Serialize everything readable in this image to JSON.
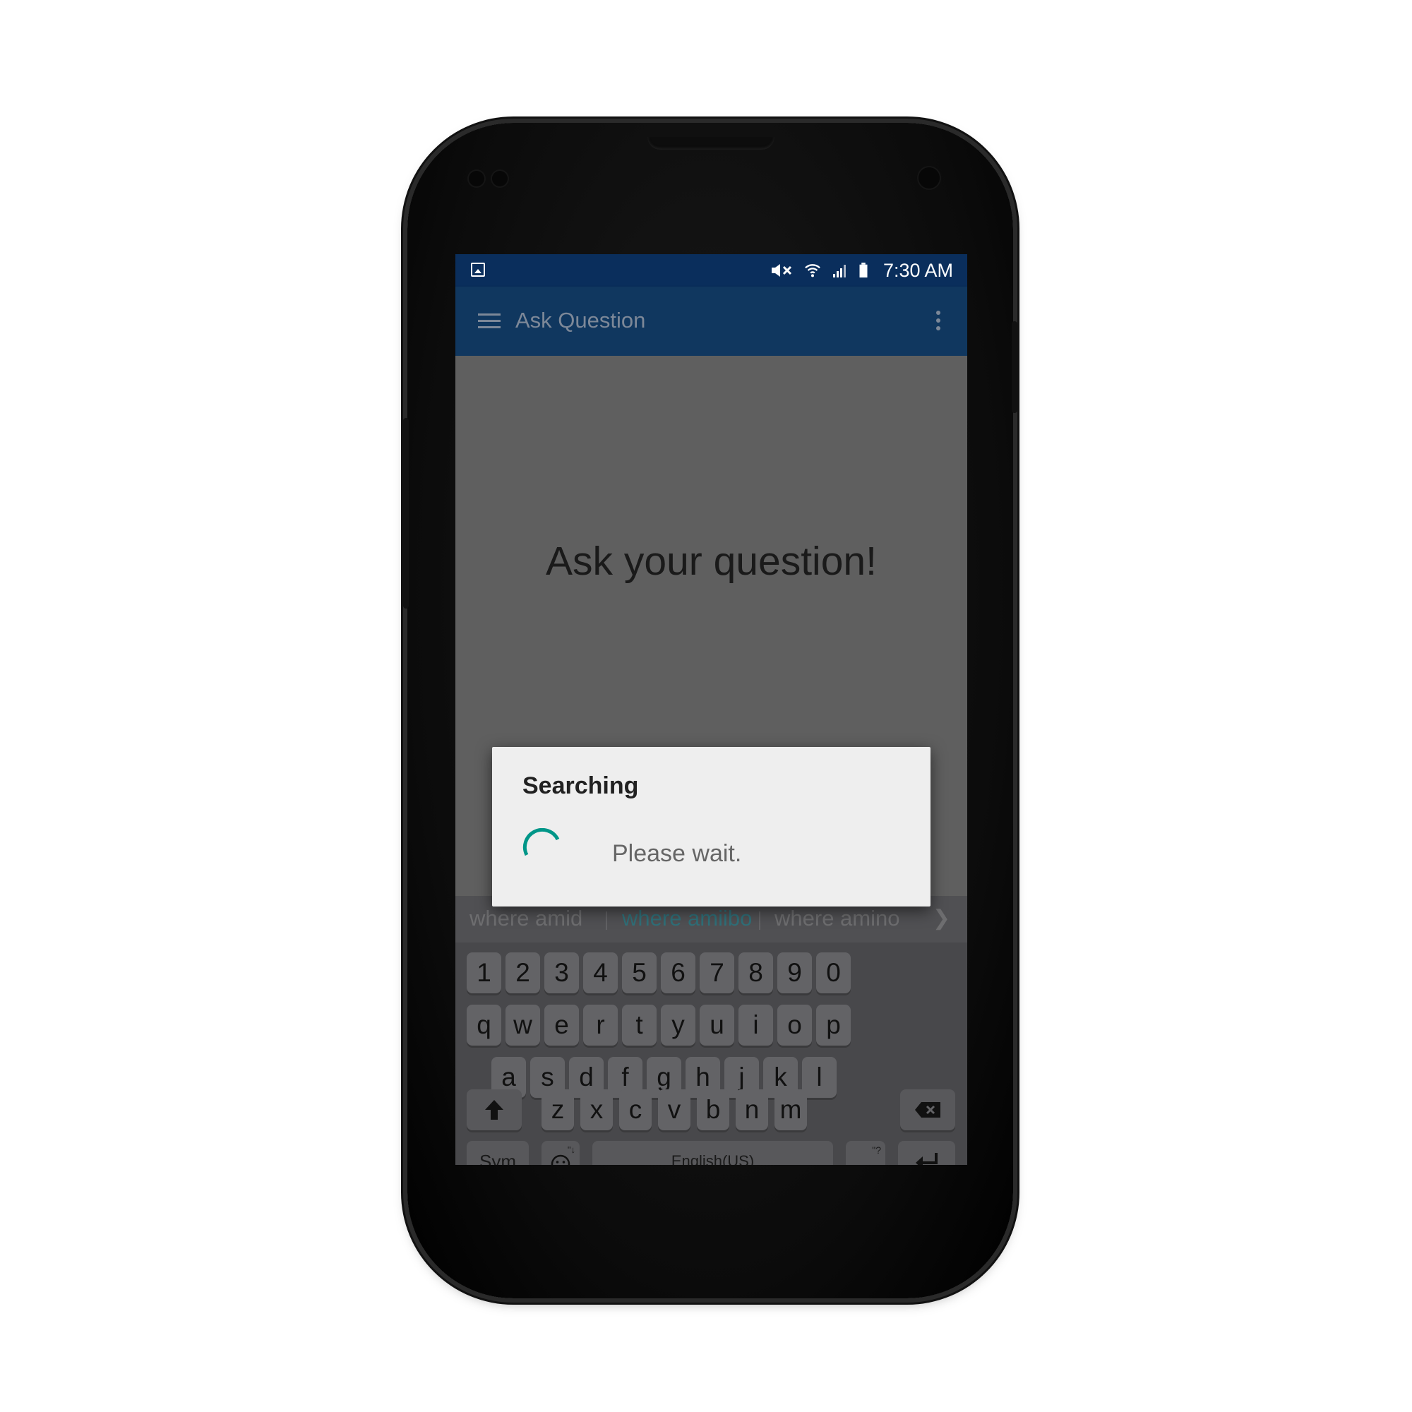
{
  "status_bar": {
    "time": "7:30 AM",
    "icons": [
      "image-notification-icon",
      "mute-icon",
      "wifi-icon",
      "signal-icon",
      "battery-icon"
    ]
  },
  "app_bar": {
    "title": "Ask Question",
    "menu_icon": "hamburger-menu-icon",
    "overflow_icon": "overflow-menu-icon"
  },
  "main": {
    "prompt": "Ask your question!"
  },
  "dialog": {
    "title": "Searching",
    "message": "Please wait."
  },
  "keyboard": {
    "suggestions": [
      "where amid",
      "where amiibo",
      "where amino"
    ],
    "row_numbers": [
      "1",
      "2",
      "3",
      "4",
      "5",
      "6",
      "7",
      "8",
      "9",
      "0"
    ],
    "row_top": [
      "q",
      "w",
      "e",
      "r",
      "t",
      "y",
      "u",
      "i",
      "o",
      "p"
    ],
    "row_home": [
      "a",
      "s",
      "d",
      "f",
      "g",
      "h",
      "j",
      "k",
      "l"
    ],
    "row_bottom": [
      "z",
      "x",
      "c",
      "v",
      "b",
      "n",
      "m"
    ],
    "sym_label": "Sym",
    "space_label": "English(US)",
    "period_label": ".",
    "period_hint": "\"?",
    "emoji_hint": "\"↓"
  },
  "colors": {
    "status_bar": "#0a2e5c",
    "app_bar": "#10375f",
    "spinner_accent": "#009688",
    "dialog_bg": "#eeeeee"
  }
}
